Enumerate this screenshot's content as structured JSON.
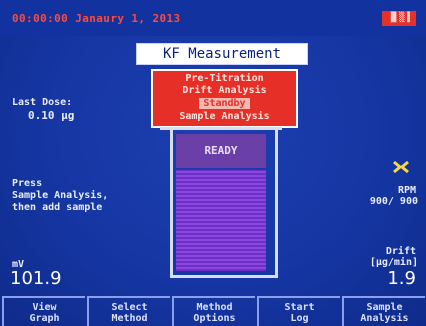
{
  "status_bar": {
    "datetime": "00:00:00 Janaury 1, 2013",
    "badge": "▐▌▒▐"
  },
  "title": "KF Measurement",
  "mode_menu": {
    "items": [
      {
        "label": "Pre-Titration",
        "selected": false
      },
      {
        "label": "Drift Analysis",
        "selected": false
      },
      {
        "label": "Standby",
        "selected": true
      },
      {
        "label": "Sample Analysis",
        "selected": false
      }
    ]
  },
  "last_dose": {
    "label": "Last Dose:",
    "value": "0.10 µg"
  },
  "instruction": [
    "Press",
    "Sample Analysis,",
    "then add sample"
  ],
  "beaker": {
    "status": "READY"
  },
  "stirrer": {
    "icon": "stirrer-icon",
    "label": "RPM",
    "value": "900/ 900"
  },
  "potential": {
    "label": "mV",
    "value": "101.9"
  },
  "drift": {
    "label": "Drift",
    "unit": "[µg/min]",
    "value": "1.9"
  },
  "softkeys": [
    {
      "line1": "View",
      "line2": "Graph"
    },
    {
      "line1": "Select",
      "line2": "Method"
    },
    {
      "line1": "Method",
      "line2": "Options"
    },
    {
      "line1": "Start",
      "line2": "Log"
    },
    {
      "line1": "Sample",
      "line2": "Analysis"
    }
  ],
  "colors": {
    "background": "#1536a3",
    "alert_red": "#e63027",
    "liquid": "#7a3fd4",
    "text": "#e8ecff"
  }
}
